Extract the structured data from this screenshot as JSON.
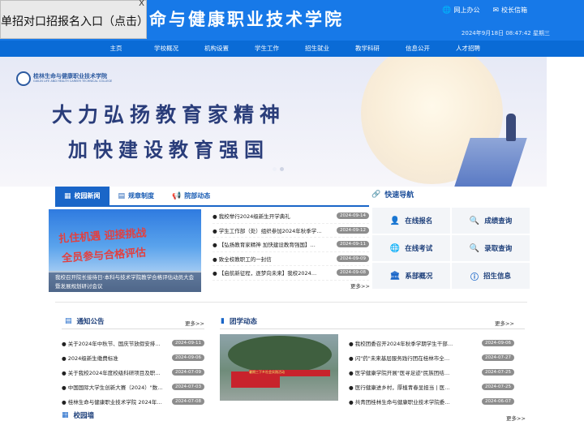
{
  "header": {
    "site_title": "生命与健康职业技术学院",
    "links": [
      {
        "icon": "globe-icon",
        "label": "网上办公"
      },
      {
        "icon": "mail-icon",
        "label": "校长信箱"
      }
    ],
    "datetime": "2024年9月18日 08:47:42 星期三"
  },
  "popup": {
    "text": "单招对口招报名入口（点击）",
    "close": "X"
  },
  "nav": {
    "items": [
      "主页",
      "学校概况",
      "机构设置",
      "学生工作",
      "招生就业",
      "教学科研",
      "信息公开",
      "人才招聘"
    ]
  },
  "banner": {
    "logo_text": "桂林生命与健康职业技术学院",
    "logo_sub": "GUILIN LIFE AND HEALTH CAREER TECHNICAL COLLEGE",
    "slogan_line1": "大力弘扬教育家精神",
    "slogan_line2": "加快建设教育强国"
  },
  "news_tabs": [
    {
      "label": "校园新闻",
      "icon": "grid-icon",
      "active": true
    },
    {
      "label": "规章制度",
      "icon": "document-icon",
      "active": false
    },
    {
      "label": "院部动态",
      "icon": "megaphone-icon",
      "active": false
    }
  ],
  "news": {
    "photo_calligraphy_line1": "扎住机遇 迎接挑战",
    "photo_calligraphy_line2": "全员参与合格评估",
    "photo_caption": "我校召开院长接待日·本科与技术学院教学合格评估动员大会暨发展规划研讨会议",
    "items": [
      {
        "title": "我校举行2024级新生开学典礼",
        "date": "2024-09-14"
      },
      {
        "title": "学生工作部（处）组织参加2024年秋季学期…",
        "date": "2024-09-12"
      },
      {
        "title": "【弘扬教育家精神 加快建设教育强国】…",
        "date": "2024-09-11"
      },
      {
        "title": "致全校教职工的一封信",
        "date": "2024-09-09"
      },
      {
        "title": "【启航新征程，逐梦向未来】我校2024…",
        "date": "2024-09-08"
      }
    ],
    "more": "更多>>"
  },
  "quick_nav": {
    "title": "快速导航",
    "icon": "link-icon",
    "items": [
      {
        "label": "在线报名",
        "icon": "user-icon"
      },
      {
        "label": "成绩查询",
        "icon": "search-icon"
      },
      {
        "label": "在线考试",
        "icon": "globe-icon"
      },
      {
        "label": "录取查询",
        "icon": "search-icon"
      },
      {
        "label": "系部概况",
        "icon": "building-icon"
      },
      {
        "label": "招生信息",
        "icon": "info-icon"
      }
    ]
  },
  "notice": {
    "title": "通知公告",
    "more": "更多>>",
    "items": [
      {
        "title": "关于2024年中秋节、国庆节放假安排的…",
        "date": "2024-09-11"
      },
      {
        "title": "2024级新生缴费标准",
        "date": "2024-09-06"
      },
      {
        "title": "关于我校2024年度校级科研项目及职业…",
        "date": "2024-07-09"
      },
      {
        "title": "中国国际大学生创新大赛（2024）\"数…",
        "date": "2024-07-03"
      },
      {
        "title": "桂林生命与健康职业技术学院 2024年…",
        "date": "2024-07-08"
      }
    ]
  },
  "league": {
    "title": "团学动态",
    "more": "更多>>",
    "photo_banner": "暑期三下乡社会实践活动",
    "items": [
      {
        "title": "我校团委召开2024年秋季学期学生干部…",
        "date": "2024-09-06"
      },
      {
        "title": "闪\"药\"未来基层服务践行团在桂林市全…",
        "date": "2024-07-27"
      },
      {
        "title": "医学健康学院开展\"医寻足迹\"民族团结…",
        "date": "2024-07-25"
      },
      {
        "title": "医行健康进乡村，厚植青春显担当 | 医…",
        "date": "2024-07-25"
      },
      {
        "title": "共青团桂林生命与健康职业技术学院委…",
        "date": "2024-06-07"
      }
    ]
  },
  "campus_wall": {
    "title": "校园墙",
    "more": "更多>>"
  },
  "colors": {
    "header_blue": "#1779e8",
    "nav_blue": "#0a6bd6",
    "accent_blue": "#1a66c8",
    "badge_gray": "#8d8d8d"
  }
}
